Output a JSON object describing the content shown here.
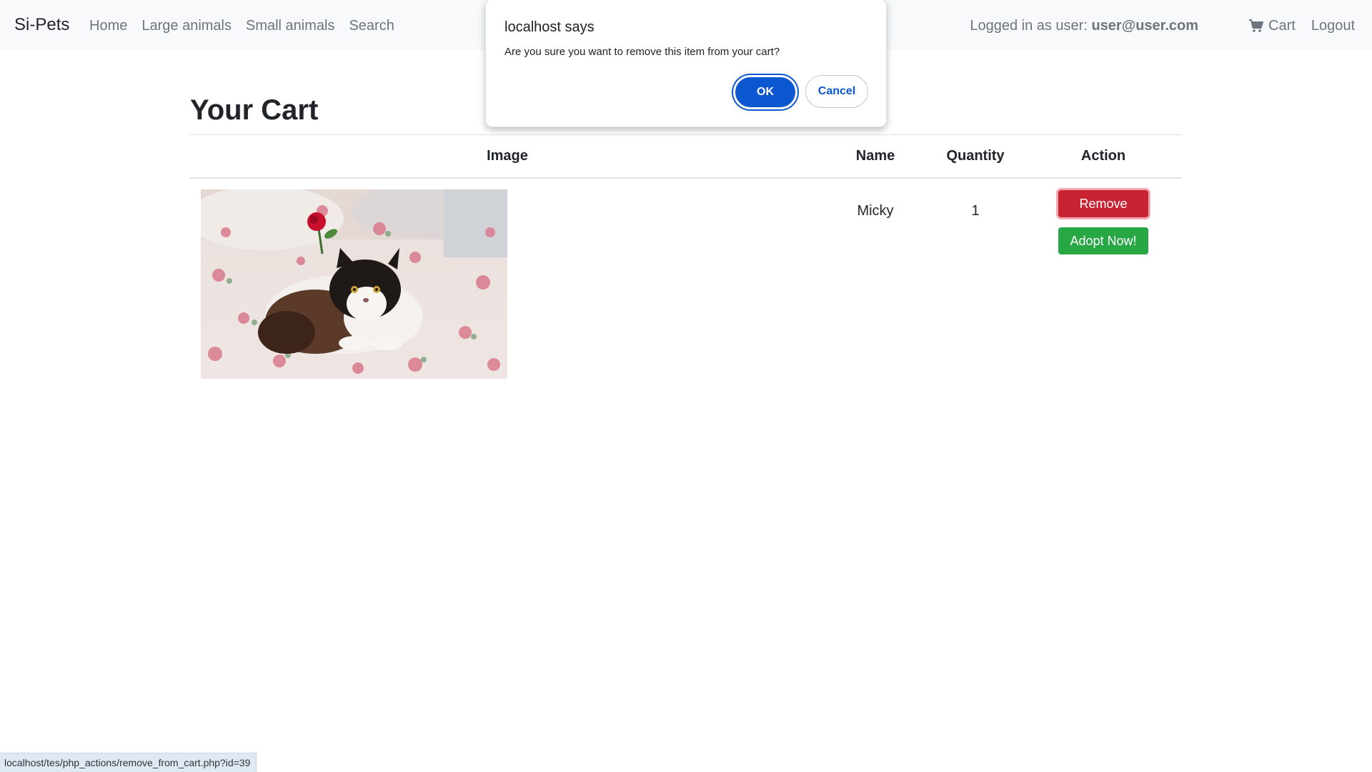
{
  "navbar": {
    "brand": "Si-Pets",
    "links": [
      "Home",
      "Large animals",
      "Small animals",
      "Search"
    ],
    "logged_in_prefix": "Logged in as user: ",
    "user_email": "user@user.com",
    "cart_label": "Cart",
    "logout_label": "Logout"
  },
  "page": {
    "title": "Your Cart"
  },
  "table": {
    "headers": {
      "image": "Image",
      "name": "Name",
      "quantity": "Quantity",
      "action": "Action"
    },
    "rows": [
      {
        "image_alt": "black and white long-haired cat lying on floral bedding with a red rose",
        "name": "Micky",
        "quantity": "1",
        "remove_label": "Remove",
        "adopt_label": "Adopt Now!"
      }
    ]
  },
  "dialog": {
    "title": "localhost says",
    "message": "Are you sure you want to remove this item from your cart?",
    "ok_label": "OK",
    "cancel_label": "Cancel"
  },
  "status_bar": {
    "url": "localhost/tes/php_actions/remove_from_cart.php?id=39"
  },
  "colors": {
    "navbar_bg": "#f8f9fa",
    "remove_button": "#c82333",
    "adopt_button": "#28a745",
    "dialog_accent": "#0b57d0"
  },
  "icons": {
    "cart": "cart-icon"
  }
}
